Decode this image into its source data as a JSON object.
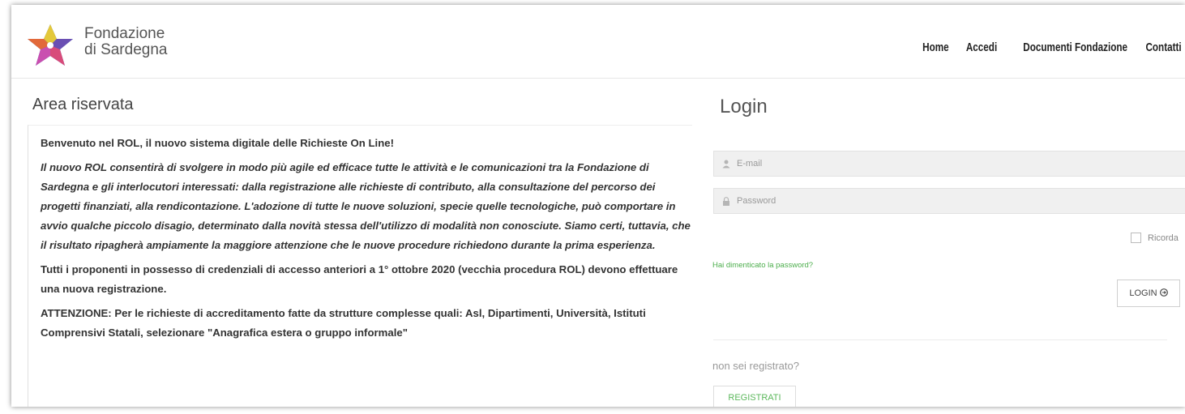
{
  "brand": {
    "line1": "Fondazione",
    "line2": "di Sardegna"
  },
  "nav": [
    "Home",
    "Accedi",
    "Documenti Fondazione",
    "Contatti"
  ],
  "area": {
    "title": "Area riservata",
    "welcome": "Benvenuto nel ROL, il nuovo sistema digitale delle Richieste On Line!",
    "intro": "Il nuovo ROL consentirà di svolgere in modo più agile ed efficace tutte le attività e le comunicazioni tra la Fondazione di Sardegna e gli interlocutori interessati: dalla registrazione alle richieste di contributo, alla consultazione del percorso dei progetti finanziati, alla rendicontazione. L'adozione di tutte le nuove soluzioni, specie quelle tecnologiche, può comportare in avvio qualche piccolo disagio, determinato dalla novità stessa dell'utilizzo di modalità non conosciute. Siamo certi, tuttavia, che il risultato ripagherà ampiamente la maggiore attenzione che le nuove procedure richiedono durante la prima esperienza.",
    "notice": "Tutti i proponenti in possesso di credenziali di accesso anteriori a 1° ottobre 2020 (vecchia procedura ROL) devono effettuare una nuova registrazione.",
    "warning": "ATTENZIONE: Per le richieste di accreditamento fatte da  strutture complesse quali: Asl, Dipartimenti, Università, Istituti Comprensivi Statali,  selezionare  \"Anagrafica estera o gruppo informale\""
  },
  "login": {
    "title": "Login",
    "email_placeholder": "E-mail",
    "password_placeholder": "Password",
    "remember_label": "Ricorda",
    "forgot_label": "Hai dimenticato la password?",
    "login_button": "LOGIN",
    "not_registered": "non sei registrato?",
    "register_button": "REGISTRATI"
  },
  "colors": {
    "accent_green": "#5cb85c"
  },
  "icons": {
    "email": "user-icon",
    "password": "lock-icon",
    "login": "circle-arrow-icon"
  }
}
